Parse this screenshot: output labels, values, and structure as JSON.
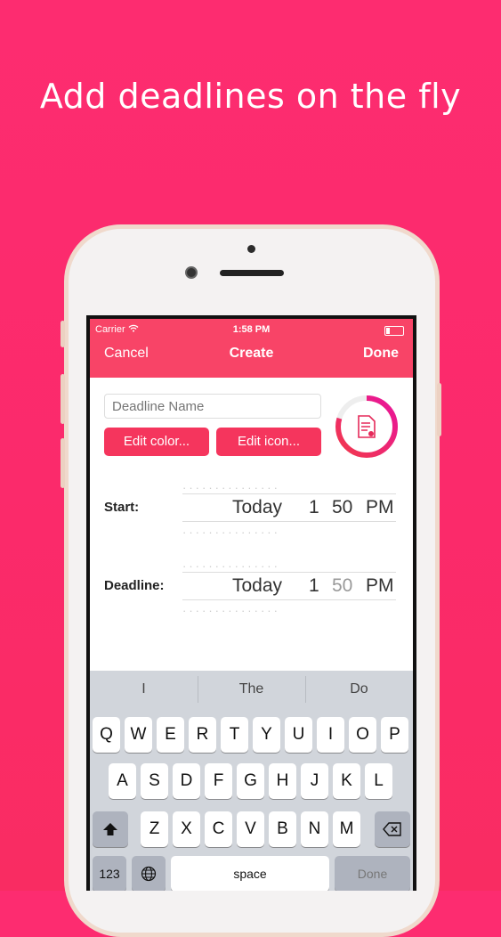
{
  "headline": "Add deadlines on the fly",
  "status_bar": {
    "carrier": "Carrier",
    "time": "1:58 PM"
  },
  "nav": {
    "cancel": "Cancel",
    "title": "Create",
    "done": "Done"
  },
  "form": {
    "name_placeholder": "Deadline Name",
    "edit_color": "Edit color...",
    "edit_icon": "Edit icon..."
  },
  "start": {
    "label": "Start:",
    "day": "Today",
    "hour": "1",
    "minute": "50",
    "ampm": "PM"
  },
  "deadline": {
    "label": "Deadline:",
    "day": "Today",
    "hour": "1",
    "minute": "50",
    "ampm": "PM"
  },
  "suggestions": [
    "I",
    "The",
    "Do"
  ],
  "keyboard": {
    "row1": [
      "Q",
      "W",
      "E",
      "R",
      "T",
      "Y",
      "U",
      "I",
      "O",
      "P"
    ],
    "row2": [
      "A",
      "S",
      "D",
      "F",
      "G",
      "H",
      "J",
      "K",
      "L"
    ],
    "row3": [
      "Z",
      "X",
      "C",
      "V",
      "B",
      "N",
      "M"
    ],
    "numbers": "123",
    "space": "space",
    "done": "Done"
  },
  "colors": {
    "background": "#fd2c70",
    "nav": "#f84467",
    "button": "#f5355d",
    "ring_start": "#f2394b",
    "ring_end": "#e8149b"
  }
}
